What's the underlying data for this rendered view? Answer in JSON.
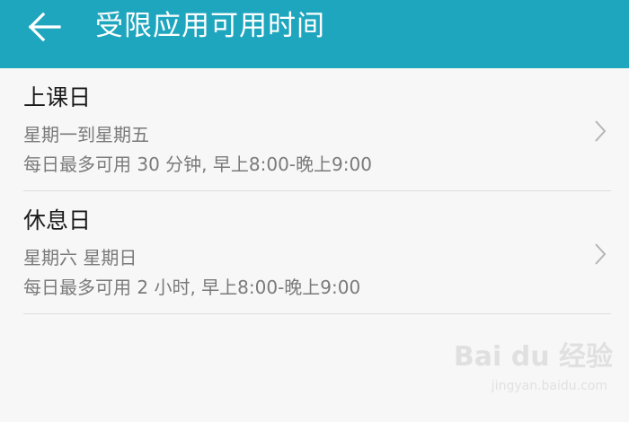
{
  "app_bar": {
    "title": "受限应用可用时间",
    "back_icon": "arrow-left-icon",
    "background_color": "#1fa6bf"
  },
  "items": [
    {
      "title": "上课日",
      "days": "星期一到星期五",
      "limit": "每日最多可用 30 分钟, 早上8:00-晚上9:00",
      "chevron_icon": "chevron-right-icon"
    },
    {
      "title": "休息日",
      "days": "星期六 星期日",
      "limit": "每日最多可用 2 小时, 早上8:00-晚上9:00",
      "chevron_icon": "chevron-right-icon"
    }
  ],
  "watermark": {
    "brand": "Bai du 经验",
    "url": "jingyan.baidu.com"
  }
}
